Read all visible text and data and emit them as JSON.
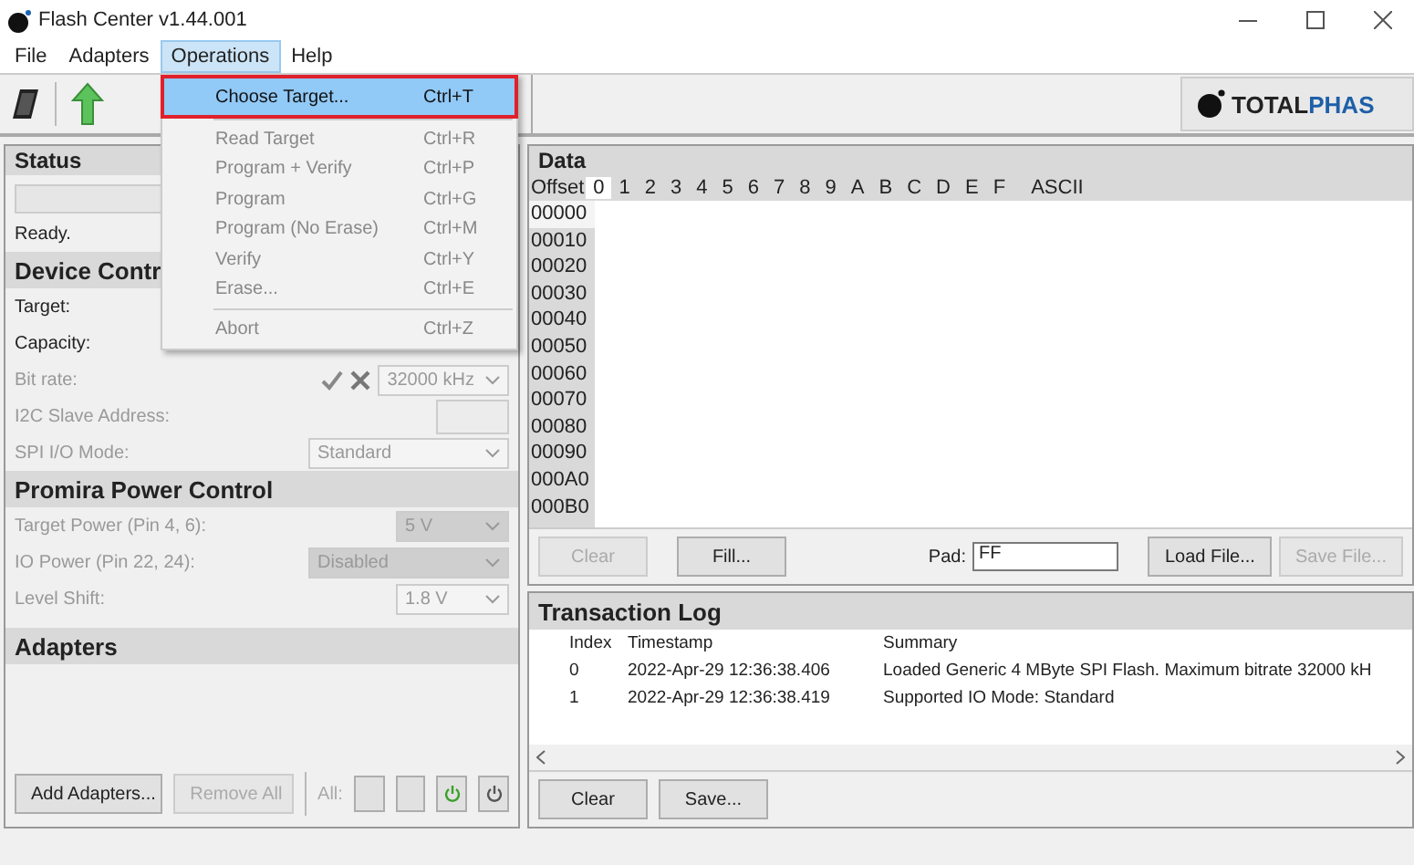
{
  "window": {
    "title": "Flash Center v1.44.001"
  },
  "menu_bar": [
    {
      "label": "File",
      "selected": false
    },
    {
      "label": "Adapters",
      "selected": false
    },
    {
      "label": "Operations",
      "selected": true
    },
    {
      "label": "Help",
      "selected": false
    }
  ],
  "operations_menu": [
    {
      "label": "Choose Target...",
      "shortcut": "Ctrl+T",
      "enabled": true,
      "highlighted": true,
      "separator_before": false
    },
    {
      "label": "Read Target",
      "shortcut": "Ctrl+R",
      "enabled": false,
      "highlighted": false,
      "separator_before": true
    },
    {
      "label": "Program + Verify",
      "shortcut": "Ctrl+P",
      "enabled": false,
      "highlighted": false,
      "separator_before": false
    },
    {
      "label": "Program",
      "shortcut": "Ctrl+G",
      "enabled": false,
      "highlighted": false,
      "separator_before": false
    },
    {
      "label": "Program (No Erase)",
      "shortcut": "Ctrl+M",
      "enabled": false,
      "highlighted": false,
      "separator_before": false
    },
    {
      "label": "Verify",
      "shortcut": "Ctrl+Y",
      "enabled": false,
      "highlighted": false,
      "separator_before": false
    },
    {
      "label": "Erase...",
      "shortcut": "Ctrl+E",
      "enabled": false,
      "highlighted": false,
      "separator_before": false
    },
    {
      "label": "Abort",
      "shortcut": "Ctrl+Z",
      "enabled": false,
      "highlighted": false,
      "separator_before": true
    }
  ],
  "logo": {
    "part_1": "TOTAL",
    "part_2": "PHAS"
  },
  "status": {
    "title": "Status",
    "message": "Ready."
  },
  "device_control": {
    "title": "Device Contr",
    "fields": [
      {
        "label": "Target:",
        "enabled": true,
        "kind": "text"
      },
      {
        "label": "Capacity:",
        "enabled": true,
        "kind": "text"
      },
      {
        "label": "Bit rate:",
        "enabled": false,
        "kind": "confirm_select",
        "value": "32000 kHz",
        "greyed": false
      },
      {
        "label": "I2C Slave Address:",
        "enabled": false,
        "kind": "input"
      },
      {
        "label": "SPI I/O Mode:",
        "enabled": false,
        "kind": "select",
        "value": "Standard",
        "greyed": false
      }
    ]
  },
  "power_control": {
    "title": "Promira Power Control",
    "fields": [
      {
        "label": "Target Power (Pin 4, 6):",
        "enabled": false,
        "kind": "select",
        "value": "5 V",
        "greyed": true
      },
      {
        "label": "IO Power (Pin 22, 24):",
        "enabled": false,
        "kind": "select",
        "value": "Disabled",
        "greyed": true
      },
      {
        "label": "Level Shift:",
        "enabled": false,
        "kind": "select",
        "value": "1.8 V",
        "greyed": false
      }
    ]
  },
  "adapters": {
    "title": "Adapters",
    "buttons": [
      {
        "label": "Add Adapters...",
        "enabled": true
      },
      {
        "label": "Remove All",
        "enabled": false
      }
    ],
    "all_label": "All:",
    "toggles": [
      {
        "kind": "blank"
      },
      {
        "kind": "blank"
      },
      {
        "kind": "power",
        "color": "#3aa02a"
      },
      {
        "kind": "power",
        "color": "#555555"
      }
    ]
  },
  "data": {
    "title": "Data",
    "columns": [
      "Offset",
      "0",
      "1",
      "2",
      "3",
      "4",
      "5",
      "6",
      "7",
      "8",
      "9",
      "A",
      "B",
      "C",
      "D",
      "E",
      "F",
      "ASCII"
    ],
    "offsets": [
      "00000",
      "00010",
      "00020",
      "00030",
      "00040",
      "00050",
      "00060",
      "00070",
      "00080",
      "00090",
      "000A0",
      "000B0"
    ],
    "buttons": [
      {
        "label": "Clear",
        "enabled": false
      },
      {
        "label": "Fill...",
        "enabled": true
      }
    ],
    "pad_label": "Pad:",
    "pad_value": "FF",
    "file_buttons": [
      {
        "label": "Load File...",
        "enabled": true
      },
      {
        "label": "Save File...",
        "enabled": false
      }
    ]
  },
  "transaction_log": {
    "title": "Transaction Log",
    "columns": [
      "Index",
      "Timestamp",
      "Summary"
    ],
    "rows": [
      {
        "index": "0",
        "timestamp": "2022-Apr-29 12:36:38.406",
        "summary": "Loaded Generic 4 MByte SPI Flash. Maximum bitrate 32000 kH"
      },
      {
        "index": "1",
        "timestamp": "2022-Apr-29 12:36:38.419",
        "summary": "Supported IO Mode: Standard"
      }
    ],
    "buttons": [
      {
        "label": "Clear",
        "enabled": true
      },
      {
        "label": "Save...",
        "enabled": true
      }
    ]
  }
}
